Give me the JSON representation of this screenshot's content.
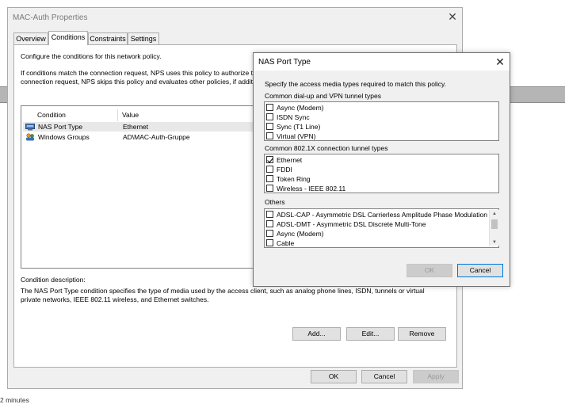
{
  "main_window": {
    "title": "MAC-Auth Properties",
    "close_glyph": "✕",
    "tabs": [
      {
        "label": "Overview"
      },
      {
        "label": "Conditions"
      },
      {
        "label": "Constraints"
      },
      {
        "label": "Settings"
      }
    ],
    "active_tab": "Conditions",
    "intro_text": "Configure the conditions for this network policy.",
    "info_line1": "If conditions match the connection request, NPS uses this policy to authorize the",
    "info_line2": "connection request, NPS skips this policy and evaluates other policies, if additi",
    "conditions_table": {
      "columns": [
        "Condition",
        "Value"
      ],
      "rows": [
        {
          "condition": "NAS Port Type",
          "value": "Ethernet",
          "icon": "nas-port-icon",
          "selected": true
        },
        {
          "condition": "Windows Groups",
          "value": "AD\\MAC-Auth-Gruppe",
          "icon": "windows-groups-icon",
          "selected": false
        }
      ]
    },
    "description_label": "Condition description:",
    "description_line1": "The NAS Port Type condition specifies the type of media used by the access client, such as analog phone lines, ISDN, tunnels or virtual",
    "description_line2": "private networks, IEEE 802.11 wireless, and Ethernet switches.",
    "buttons": {
      "add": "Add...",
      "edit": "Edit...",
      "remove": "Remove",
      "ok": "OK",
      "cancel": "Cancel",
      "apply": "Apply"
    }
  },
  "nas_dialog": {
    "title": "NAS Port Type",
    "close_glyph": "✕",
    "instructions": "Specify the access media types required to match this policy.",
    "groups": [
      {
        "label": "Common dial-up and VPN tunnel types",
        "items": [
          {
            "label": "Async (Modem)",
            "checked": false
          },
          {
            "label": "ISDN Sync",
            "checked": false
          },
          {
            "label": "Sync (T1 Line)",
            "checked": false
          },
          {
            "label": "Virtual (VPN)",
            "checked": false
          }
        ]
      },
      {
        "label": "Common 802.1X connection tunnel types",
        "items": [
          {
            "label": "Ethernet",
            "checked": true
          },
          {
            "label": "FDDI",
            "checked": false
          },
          {
            "label": "Token Ring",
            "checked": false
          },
          {
            "label": "Wireless - IEEE 802.11",
            "checked": false
          }
        ]
      },
      {
        "label": "Others",
        "items": [
          {
            "label": "ADSL-CAP - Asymmetric DSL Carrierless Amplitude Phase Modulation",
            "checked": false
          },
          {
            "label": "ADSL-DMT - Asymmetric DSL Discrete Multi-Tone",
            "checked": false
          },
          {
            "label": "Async (Modem)",
            "checked": false
          },
          {
            "label": "Cable",
            "checked": false
          }
        ]
      }
    ],
    "buttons": {
      "ok": "OK",
      "cancel": "Cancel"
    },
    "ok_enabled": false
  },
  "footer": {
    "text": "2 minutes"
  },
  "colors": {
    "selected_row": "#e8e8e8",
    "default_button_border": "#0078d7",
    "window_bg": "#f0f0f0"
  }
}
